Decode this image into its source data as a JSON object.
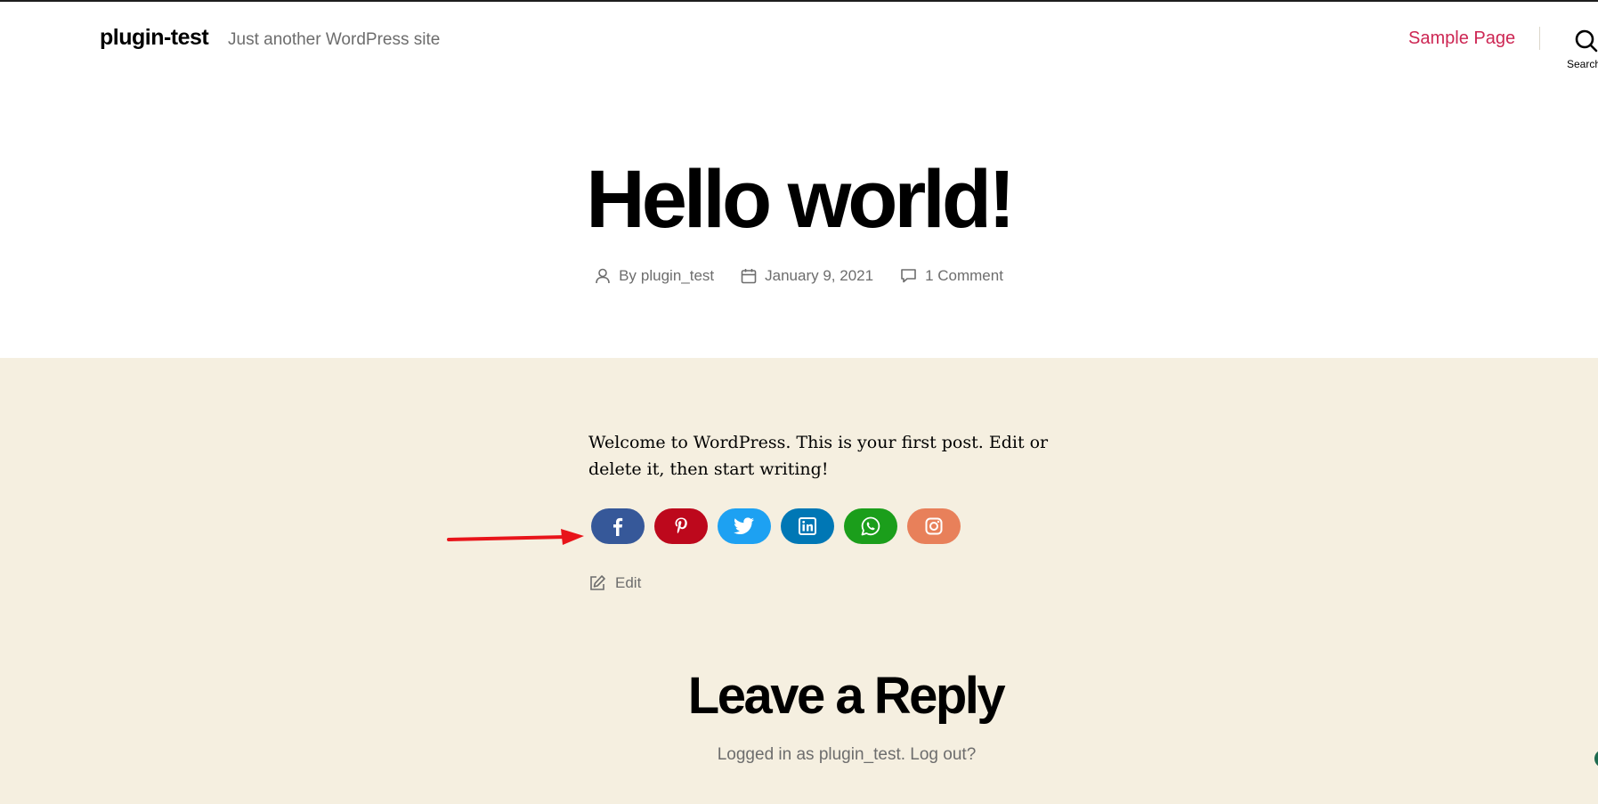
{
  "header": {
    "site_title": "plugin-test",
    "site_description": "Just another WordPress site",
    "nav_items": [
      {
        "label": "Sample Page"
      }
    ],
    "search_label": "Search"
  },
  "post": {
    "title": "Hello world!",
    "meta": {
      "author_prefix": "By",
      "author": "plugin_test",
      "date": "January 9, 2021",
      "comments": "1 Comment"
    },
    "content": "Welcome to WordPress. This is your first post. Edit or delete it, then start writing!",
    "edit_label": "Edit"
  },
  "share_buttons": [
    {
      "network": "facebook",
      "icon": "facebook-icon",
      "color": "#365899"
    },
    {
      "network": "pinterest",
      "icon": "pinterest-icon",
      "color": "#bd081c"
    },
    {
      "network": "twitter",
      "icon": "twitter-icon",
      "color": "#1da1f2"
    },
    {
      "network": "linkedin",
      "icon": "linkedin-icon",
      "color": "#0077b5"
    },
    {
      "network": "whatsapp",
      "icon": "whatsapp-icon",
      "color": "#1b9e1b"
    },
    {
      "network": "instagram",
      "icon": "instagram-icon",
      "color": "#e8805a"
    }
  ],
  "comments": {
    "title": "Leave a Reply",
    "logged_in_text": "Logged in as plugin_test.",
    "logout_label": "Log out?"
  },
  "colors": {
    "accent": "#cd2653",
    "content_background": "#f5efe0",
    "meta_text": "#6d6d6d",
    "annotation_arrow": "#e8141a"
  }
}
